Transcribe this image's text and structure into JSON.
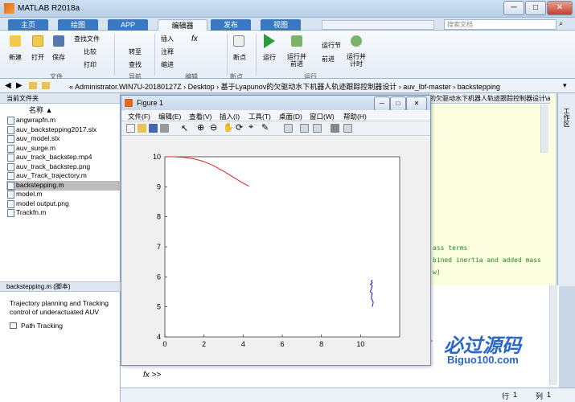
{
  "window": {
    "title": "MATLAB R2018a",
    "min": "─",
    "max": "□",
    "close": "✕"
  },
  "tabs": [
    {
      "label": "主页"
    },
    {
      "label": "绘图"
    },
    {
      "label": "APP"
    },
    {
      "label": "编辑器"
    },
    {
      "label": "发布"
    },
    {
      "label": "视图"
    }
  ],
  "search": {
    "placeholder": "搜索文档"
  },
  "ribbon": {
    "new": "新建",
    "open": "打开",
    "save": "保存",
    "find_files": "查找文件",
    "compare": "比较",
    "print": "打印",
    "goto": "转至",
    "find": "查找",
    "insert": "插入",
    "comment": "注释",
    "indent": "缩进",
    "breakpoints": "断点",
    "run": "运行",
    "run_advance": "运行并\n前进",
    "run_section": "运行节",
    "advance": "前进",
    "run_time": "运行并\n计时",
    "groups": {
      "file": "文件",
      "navigate": "导航",
      "edit": "编辑",
      "breakpoints": "断点",
      "run": "运行"
    }
  },
  "address": {
    "path": "« Administrator.WIN7U-20180127Z › Desktop › 基于Lyapunov的欠驱动水下机器人轨迹跟踪控制器设计 › auv_lbf-master › backstepping"
  },
  "current_folder": {
    "title": "当前文件夹",
    "col_name": "名称 ▲",
    "files": [
      "angwrapfn.m",
      "auv_backstepping2017.slx",
      "auv_model.slx",
      "auv_surge.m",
      "auv_track_backstep.mp4",
      "auv_track_backstep.png",
      "auv_Track_trajectory.m",
      "backstepping.m",
      "model.m",
      "model output.png",
      "Trackfn.m"
    ],
    "selected": "backstepping.m"
  },
  "details": {
    "title": "backstepping.m  (脚本)",
    "description": "Trajectory planning and Tracking control of underactuated AUV",
    "item": "Path Tracking"
  },
  "editor": {
    "tab": "的欠驱动水下机器人轨迹跟踪控制器设计\\auv_l...",
    "lines": [
      "ass terms",
      "bined inertia and added mass",
      "w)"
    ],
    "side_label": "工作区"
  },
  "command": {
    "prompt": "fx >>"
  },
  "status": {
    "row_label": "行",
    "row": "1",
    "col_label": "列",
    "col": "1"
  },
  "figure": {
    "title": "Figure 1",
    "menu": [
      "文件(F)",
      "编辑(E)",
      "查看(V)",
      "插入(I)",
      "工具(T)",
      "桌面(D)",
      "窗口(W)",
      "帮助(H)"
    ]
  },
  "watermark": {
    "text": "必过源码",
    "url": "Biguo100.com"
  },
  "chart_data": {
    "type": "line",
    "xlim": [
      0,
      12
    ],
    "ylim": [
      4,
      10
    ],
    "xticks": [
      0,
      2,
      4,
      6,
      8,
      10
    ],
    "yticks": [
      4,
      5,
      6,
      7,
      8,
      9,
      10
    ],
    "series": [
      {
        "color": "#e02020",
        "x": [
          0,
          0.5,
          1,
          1.5,
          2,
          2.5,
          3,
          3.5,
          4,
          4.3
        ],
        "y": [
          10,
          10,
          9.98,
          9.93,
          9.84,
          9.7,
          9.52,
          9.32,
          9.12,
          9.02
        ]
      },
      {
        "color": "#1a1acc",
        "x": [
          10.6,
          10.65,
          10.55,
          10.6,
          10.5,
          10.55,
          10.6,
          10.5,
          10.6,
          10.55,
          10.6
        ],
        "y": [
          5.0,
          5.15,
          5.3,
          5.45,
          5.5,
          5.6,
          5.7,
          5.75,
          5.8,
          5.85,
          5.9
        ]
      }
    ]
  }
}
